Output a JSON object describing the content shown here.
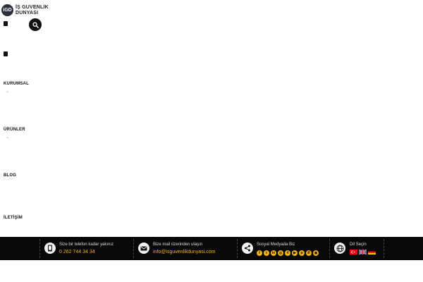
{
  "header": {
    "logo_mark": "iGD",
    "logo_line1": "İŞ GUVENLIK",
    "logo_line2": "DUNYASI"
  },
  "nav": {
    "items": [
      {
        "label": "KURUMSAL",
        "has_submenu": true
      },
      {
        "label": "ÜRÜNLER",
        "has_submenu": true
      },
      {
        "label": "BLOG",
        "has_submenu": false
      },
      {
        "label": "İLETİŞİM",
        "has_submenu": false
      }
    ],
    "caret": "⌄"
  },
  "footer": {
    "phone": {
      "title": "Size bir telefon kadar yakınız",
      "value": "0 262 744 34 34",
      "icon": "phone-icon"
    },
    "mail": {
      "title": "Bize mail üzerinden ulaşın",
      "value": "info@isguvenlikdunyasi.com",
      "icon": "mail-icon"
    },
    "social": {
      "title": "Sosyal Medyada Biz",
      "icon": "share-icon",
      "accent": "#f0b21b",
      "links": [
        {
          "name": "facebook-icon",
          "glyph": "f"
        },
        {
          "name": "twitter-icon",
          "glyph": "t"
        },
        {
          "name": "linkedin-icon",
          "glyph": "in"
        },
        {
          "name": "instagram-icon",
          "glyph": "◎"
        },
        {
          "name": "foursquare-icon",
          "glyph": "4"
        },
        {
          "name": "youtube-icon",
          "glyph": "▶"
        },
        {
          "name": "pinterest-icon",
          "glyph": "p"
        },
        {
          "name": "whatsapp-icon",
          "glyph": "✆"
        },
        {
          "name": "rss-icon",
          "glyph": "◉"
        }
      ]
    },
    "language": {
      "title": "Dil Seçin",
      "icon": "globe-icon",
      "flags": [
        "turkish-flag",
        "english-flag",
        "german-flag"
      ]
    }
  }
}
